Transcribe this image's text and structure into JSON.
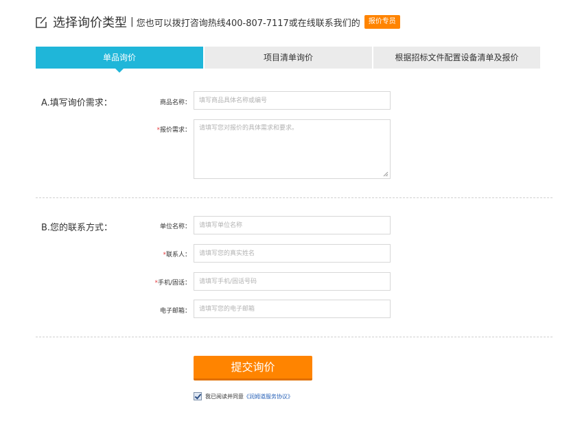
{
  "header": {
    "icon": "edit-icon",
    "title": "选择询价类型",
    "separator": "|",
    "hotline_text": "您也可以拨打咨询热线400-807-7117或在线联系我们的",
    "badge": "报价专员",
    "badge_color": "#ff8400"
  },
  "tabs": [
    {
      "label": "单品询价",
      "active": true
    },
    {
      "label": "项目清单询价",
      "active": false
    },
    {
      "label": "根据招标文件配置设备清单及报价",
      "active": false
    }
  ],
  "colors": {
    "accent": "#1fb6d9",
    "button": "#ff8400",
    "required": "#e4393c"
  },
  "section_a": {
    "title": "A.填写询价需求：",
    "product_name": {
      "label": "商品名称：",
      "placeholder": "填写商品具体名称或编号"
    },
    "quote_request": {
      "required_mark": "*",
      "label": "报价需求：",
      "placeholder": "请填写您对报价的具体需求和要求。"
    }
  },
  "section_b": {
    "title": "B.您的联系方式：",
    "company": {
      "label": "单位名称：",
      "placeholder": "请填写单位名称"
    },
    "contact": {
      "required_mark": "*",
      "label": "联系人：",
      "placeholder": "请填写您的真实姓名"
    },
    "phone": {
      "required_mark": "*",
      "label": "手机/固话：",
      "placeholder": "请填写手机/固话号码"
    },
    "email": {
      "label": "电子邮箱：",
      "placeholder": "请填写您的电子邮箱"
    }
  },
  "submit_label": "提交询价",
  "agreement": {
    "checked": true,
    "text": "我已阅读并同意",
    "link": "《润姆道服务协议》"
  }
}
